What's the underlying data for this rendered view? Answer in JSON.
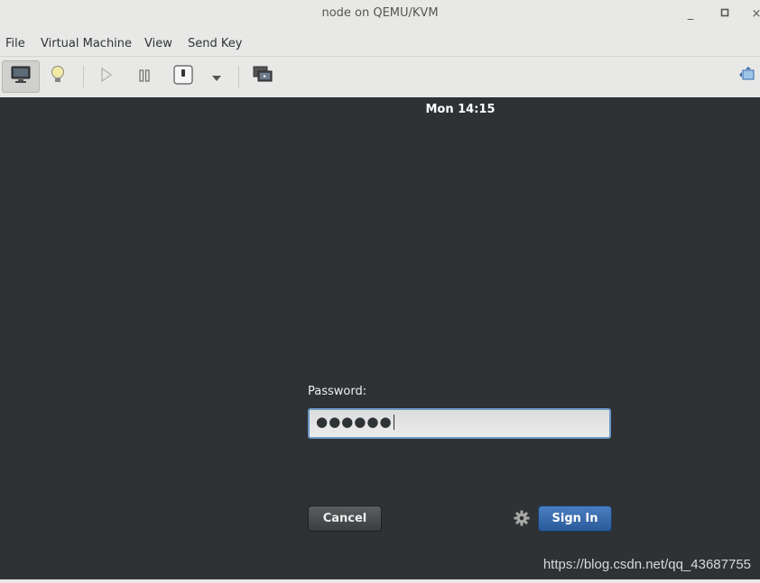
{
  "window": {
    "title": "node on QEMU/KVM",
    "minimize_glyph": "_",
    "maximize_glyph": "□",
    "close_glyph": "×"
  },
  "menubar": {
    "items": [
      "File",
      "Virtual Machine",
      "View",
      "Send Key"
    ]
  },
  "toolbar": {
    "buttons": [
      {
        "icon": "monitor-icon",
        "active": true
      },
      {
        "icon": "lightbulb-icon"
      },
      {
        "icon": "play-icon",
        "disabled": true
      },
      {
        "icon": "pause-icon"
      },
      {
        "icon": "power-icon"
      },
      {
        "icon": "chevron-down-icon"
      },
      {
        "icon": "snapshots-icon"
      },
      {
        "icon": "fullscreen-icon"
      }
    ]
  },
  "guest": {
    "clock": "Mon 14:15",
    "password_label": "Password:",
    "password_value": "●●●●●●",
    "cancel_label": "Cancel",
    "signin_label": "Sign In",
    "settings_icon": "gear-icon"
  },
  "watermark": "https://blog.csdn.net/qq_43687755",
  "colors": {
    "background": "#2e3234",
    "signin_accent": "#3a6aab",
    "input_focus": "#6c98c8"
  }
}
